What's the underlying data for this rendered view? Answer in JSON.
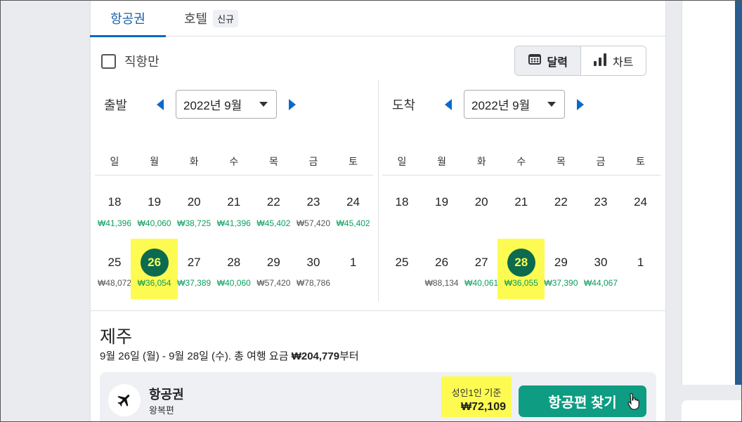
{
  "tabs": {
    "flights": "항공권",
    "hotel": "호텔",
    "hotel_badge": "신규"
  },
  "filters": {
    "direct_only": "직항만",
    "calendar": "달력",
    "chart": "차트"
  },
  "departure": {
    "label": "출발",
    "month": "2022년 9월",
    "weekdays": [
      "일",
      "월",
      "화",
      "수",
      "목",
      "금",
      "토"
    ],
    "week1": [
      {
        "day": "18",
        "price": "₩41,396",
        "tone": "green"
      },
      {
        "day": "19",
        "price": "₩40,060",
        "tone": "green"
      },
      {
        "day": "20",
        "price": "₩38,725",
        "tone": "green"
      },
      {
        "day": "21",
        "price": "₩41,396",
        "tone": "green"
      },
      {
        "day": "22",
        "price": "₩45,402",
        "tone": "green"
      },
      {
        "day": "23",
        "price": "₩57,420",
        "tone": "grey"
      },
      {
        "day": "24",
        "price": "₩45,402",
        "tone": "green"
      }
    ],
    "week2": [
      {
        "day": "25",
        "price": "₩48,072",
        "tone": "grey"
      },
      {
        "day": "26",
        "price": "₩36,054",
        "tone": "green",
        "selected": true
      },
      {
        "day": "27",
        "price": "₩37,389",
        "tone": "green"
      },
      {
        "day": "28",
        "price": "₩40,060",
        "tone": "green"
      },
      {
        "day": "29",
        "price": "₩57,420",
        "tone": "grey"
      },
      {
        "day": "30",
        "price": "₩78,786",
        "tone": "grey"
      },
      {
        "day": "1",
        "price": "",
        "tone": "muted"
      }
    ]
  },
  "arrival": {
    "label": "도착",
    "month": "2022년 9월",
    "weekdays": [
      "일",
      "월",
      "화",
      "수",
      "목",
      "금",
      "토"
    ],
    "week1": [
      {
        "day": "18",
        "price": "",
        "tone": "muted"
      },
      {
        "day": "19",
        "price": "",
        "tone": "muted"
      },
      {
        "day": "20",
        "price": "",
        "tone": "muted"
      },
      {
        "day": "21",
        "price": "",
        "tone": "muted"
      },
      {
        "day": "22",
        "price": "",
        "tone": "muted"
      },
      {
        "day": "23",
        "price": "",
        "tone": "muted"
      },
      {
        "day": "24",
        "price": "",
        "tone": "muted"
      }
    ],
    "week2": [
      {
        "day": "25",
        "price": "",
        "tone": "muted"
      },
      {
        "day": "26",
        "price": "₩88,134",
        "tone": "grey"
      },
      {
        "day": "27",
        "price": "₩40,061",
        "tone": "green"
      },
      {
        "day": "28",
        "price": "₩36,055",
        "tone": "green",
        "selected": true
      },
      {
        "day": "29",
        "price": "₩37,390",
        "tone": "green"
      },
      {
        "day": "30",
        "price": "₩44,067",
        "tone": "green"
      },
      {
        "day": "1",
        "price": "",
        "tone": "muted"
      }
    ]
  },
  "summary": {
    "destination": "제주",
    "dates_text": "9월 26일 (월) - 9월 28일 (수). 총 여행 요금 ",
    "total": "₩204,779",
    "suffix": "부터"
  },
  "result": {
    "title": "항공권",
    "subtitle": "왕복편",
    "price_label": "성인1인 기준",
    "price": "₩72,109",
    "button": "항공편 찾기"
  },
  "colors": {
    "accent": "#0b6ac8",
    "green_price": "#0a9e5e",
    "selected": "#0c6b4f",
    "highlight": "#fdfb52",
    "button": "#0e9c82"
  }
}
